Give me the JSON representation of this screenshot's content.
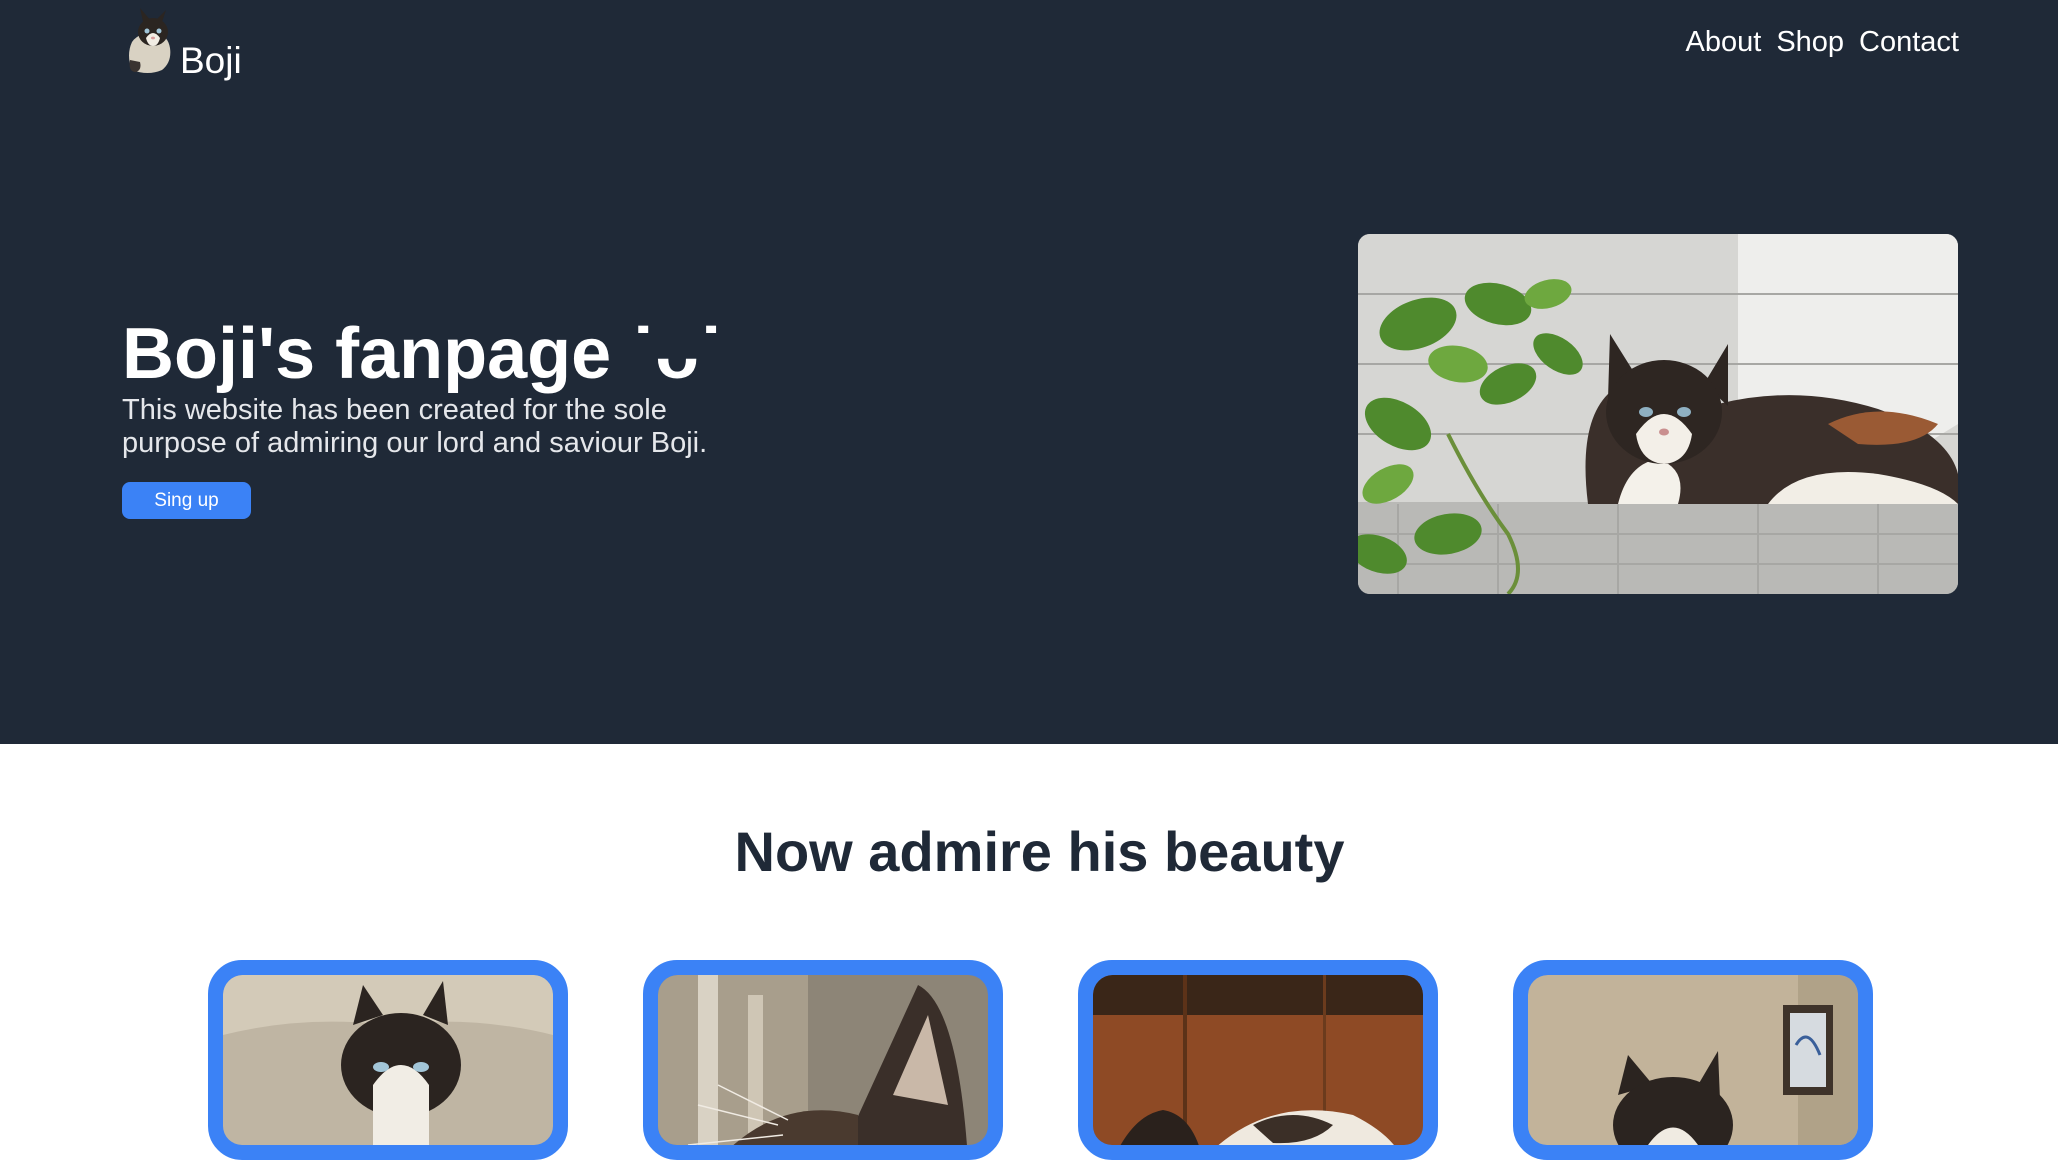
{
  "header": {
    "brand": "Boji",
    "nav": [
      {
        "label": "About"
      },
      {
        "label": "Shop"
      },
      {
        "label": "Contact"
      }
    ]
  },
  "hero": {
    "title": "Boji's fanpage ˙ᴗ˙",
    "description": "This website has been created for the sole purpose of admiring our lord and saviour Boji.",
    "cta_label": "Sing up"
  },
  "gallery": {
    "title": "Now admire his beauty",
    "photo_count": 4
  },
  "colors": {
    "hero_background": "#1f2937",
    "accent": "#3b82f6",
    "heading": "#1f2937",
    "page_background": "#ffffff"
  }
}
